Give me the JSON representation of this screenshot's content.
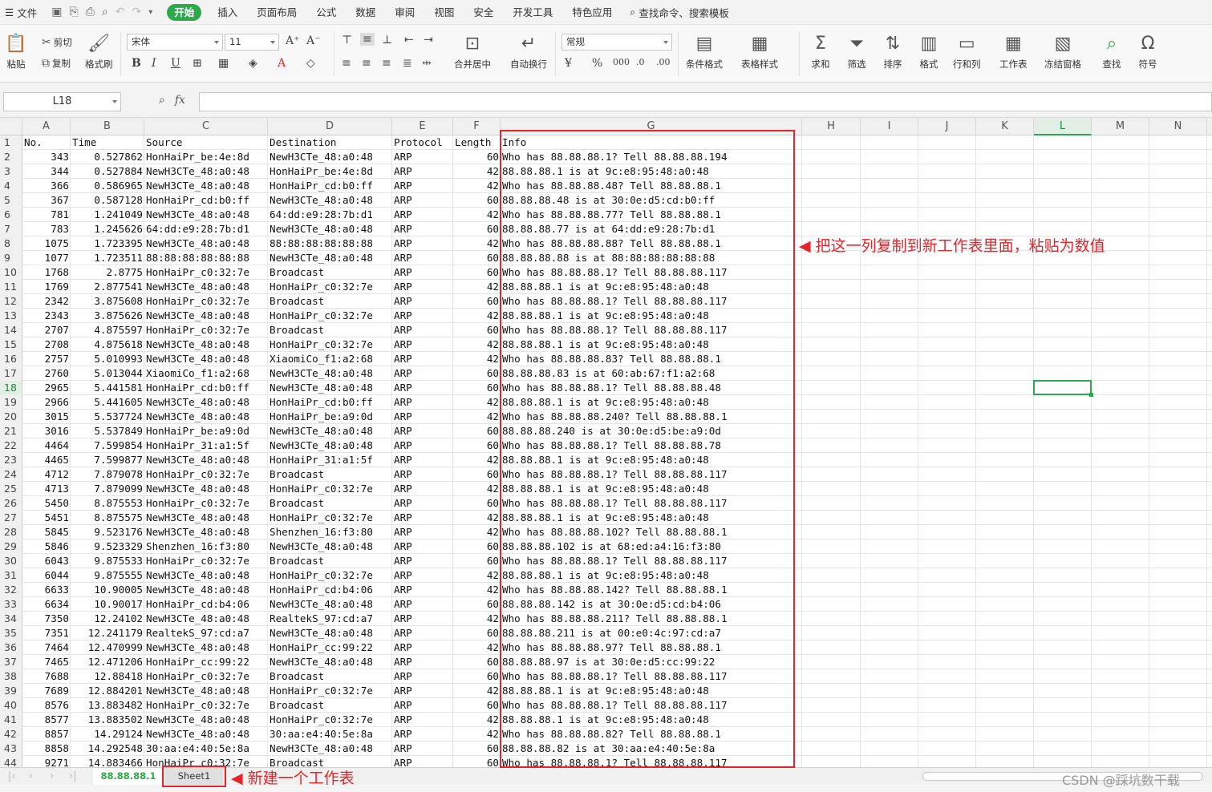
{
  "menubar": {
    "file": "文件",
    "tabs": [
      "开始",
      "插入",
      "页面布局",
      "公式",
      "数据",
      "审阅",
      "视图",
      "安全",
      "开发工具",
      "特色应用"
    ],
    "active": "开始",
    "search": "查找命令、搜索模板"
  },
  "ribbon": {
    "paste": "粘贴",
    "cut": "剪切",
    "copy": "复制",
    "format_painter": "格式刷",
    "font": "宋体",
    "size": "11",
    "merge": "合并居中",
    "wrap": "自动换行",
    "number_format": "常规",
    "cond_format": "条件格式",
    "table_style": "表格样式",
    "sum": "求和",
    "filter": "筛选",
    "sort": "排序",
    "format": "格式",
    "rowcol": "行和列",
    "worksheet": "工作表",
    "freeze": "冻结窗格",
    "find": "查找",
    "symbol": "符号"
  },
  "formula": {
    "name_box": "L18",
    "fx": "fx"
  },
  "columns": [
    "A",
    "B",
    "C",
    "D",
    "E",
    "F",
    "G",
    "H",
    "I",
    "J",
    "K",
    "L",
    "M",
    "N"
  ],
  "selected_column": "L",
  "selected_row": "18",
  "header_row": [
    "No.",
    "Time",
    "Source",
    "Destination",
    "Protocol",
    "Length",
    "Info"
  ],
  "rows": [
    [
      "343",
      "0.527862",
      "HonHaiPr_be:4e:8d",
      "NewH3CTe_48:a0:48",
      "ARP",
      "60",
      "Who has 88.88.88.1? Tell 88.88.88.194"
    ],
    [
      "344",
      "0.527884",
      "NewH3CTe_48:a0:48",
      "HonHaiPr_be:4e:8d",
      "ARP",
      "42",
      "88.88.88.1 is at 9c:e8:95:48:a0:48"
    ],
    [
      "366",
      "0.586965",
      "NewH3CTe_48:a0:48",
      "HonHaiPr_cd:b0:ff",
      "ARP",
      "42",
      "Who has 88.88.88.48? Tell 88.88.88.1"
    ],
    [
      "367",
      "0.587128",
      "HonHaiPr_cd:b0:ff",
      "NewH3CTe_48:a0:48",
      "ARP",
      "60",
      "88.88.88.48 is at 30:0e:d5:cd:b0:ff"
    ],
    [
      "781",
      "1.241049",
      "NewH3CTe_48:a0:48",
      "64:dd:e9:28:7b:d1",
      "ARP",
      "42",
      "Who has 88.88.88.77? Tell 88.88.88.1"
    ],
    [
      "783",
      "1.245626",
      "64:dd:e9:28:7b:d1",
      "NewH3CTe_48:a0:48",
      "ARP",
      "60",
      "88.88.88.77 is at 64:dd:e9:28:7b:d1"
    ],
    [
      "1075",
      "1.723395",
      "NewH3CTe_48:a0:48",
      "88:88:88:88:88:88",
      "ARP",
      "42",
      "Who has 88.88.88.88? Tell 88.88.88.1"
    ],
    [
      "1077",
      "1.723511",
      "88:88:88:88:88:88",
      "NewH3CTe_48:a0:48",
      "ARP",
      "60",
      "88.88.88.88 is at 88:88:88:88:88:88"
    ],
    [
      "1768",
      "2.8775",
      "HonHaiPr_c0:32:7e",
      "Broadcast",
      "ARP",
      "60",
      "Who has 88.88.88.1? Tell 88.88.88.117"
    ],
    [
      "1769",
      "2.877541",
      "NewH3CTe_48:a0:48",
      "HonHaiPr_c0:32:7e",
      "ARP",
      "42",
      "88.88.88.1 is at 9c:e8:95:48:a0:48"
    ],
    [
      "2342",
      "3.875608",
      "HonHaiPr_c0:32:7e",
      "Broadcast",
      "ARP",
      "60",
      "Who has 88.88.88.1? Tell 88.88.88.117"
    ],
    [
      "2343",
      "3.875626",
      "NewH3CTe_48:a0:48",
      "HonHaiPr_c0:32:7e",
      "ARP",
      "42",
      "88.88.88.1 is at 9c:e8:95:48:a0:48"
    ],
    [
      "2707",
      "4.875597",
      "HonHaiPr_c0:32:7e",
      "Broadcast",
      "ARP",
      "60",
      "Who has 88.88.88.1? Tell 88.88.88.117"
    ],
    [
      "2708",
      "4.875618",
      "NewH3CTe_48:a0:48",
      "HonHaiPr_c0:32:7e",
      "ARP",
      "42",
      "88.88.88.1 is at 9c:e8:95:48:a0:48"
    ],
    [
      "2757",
      "5.010993",
      "NewH3CTe_48:a0:48",
      "XiaomiCo_f1:a2:68",
      "ARP",
      "42",
      "Who has 88.88.88.83? Tell 88.88.88.1"
    ],
    [
      "2760",
      "5.013044",
      "XiaomiCo_f1:a2:68",
      "NewH3CTe_48:a0:48",
      "ARP",
      "60",
      "88.88.88.83 is at 60:ab:67:f1:a2:68"
    ],
    [
      "2965",
      "5.441581",
      "HonHaiPr_cd:b0:ff",
      "NewH3CTe_48:a0:48",
      "ARP",
      "60",
      "Who has 88.88.88.1? Tell 88.88.88.48"
    ],
    [
      "2966",
      "5.441605",
      "NewH3CTe_48:a0:48",
      "HonHaiPr_cd:b0:ff",
      "ARP",
      "42",
      "88.88.88.1 is at 9c:e8:95:48:a0:48"
    ],
    [
      "3015",
      "5.537724",
      "NewH3CTe_48:a0:48",
      "HonHaiPr_be:a9:0d",
      "ARP",
      "42",
      "Who has 88.88.88.240? Tell 88.88.88.1"
    ],
    [
      "3016",
      "5.537849",
      "HonHaiPr_be:a9:0d",
      "NewH3CTe_48:a0:48",
      "ARP",
      "60",
      "88.88.88.240 is at 30:0e:d5:be:a9:0d"
    ],
    [
      "4464",
      "7.599854",
      "HonHaiPr_31:a1:5f",
      "NewH3CTe_48:a0:48",
      "ARP",
      "60",
      "Who has 88.88.88.1? Tell 88.88.88.78"
    ],
    [
      "4465",
      "7.599877",
      "NewH3CTe_48:a0:48",
      "HonHaiPr_31:a1:5f",
      "ARP",
      "42",
      "88.88.88.1 is at 9c:e8:95:48:a0:48"
    ],
    [
      "4712",
      "7.879078",
      "HonHaiPr_c0:32:7e",
      "Broadcast",
      "ARP",
      "60",
      "Who has 88.88.88.1? Tell 88.88.88.117"
    ],
    [
      "4713",
      "7.879099",
      "NewH3CTe_48:a0:48",
      "HonHaiPr_c0:32:7e",
      "ARP",
      "42",
      "88.88.88.1 is at 9c:e8:95:48:a0:48"
    ],
    [
      "5450",
      "8.875553",
      "HonHaiPr_c0:32:7e",
      "Broadcast",
      "ARP",
      "60",
      "Who has 88.88.88.1? Tell 88.88.88.117"
    ],
    [
      "5451",
      "8.875575",
      "NewH3CTe_48:a0:48",
      "HonHaiPr_c0:32:7e",
      "ARP",
      "42",
      "88.88.88.1 is at 9c:e8:95:48:a0:48"
    ],
    [
      "5845",
      "9.523176",
      "NewH3CTe_48:a0:48",
      "Shenzhen_16:f3:80",
      "ARP",
      "42",
      "Who has 88.88.88.102? Tell 88.88.88.1"
    ],
    [
      "5846",
      "9.523329",
      "Shenzhen_16:f3:80",
      "NewH3CTe_48:a0:48",
      "ARP",
      "60",
      "88.88.88.102 is at 68:ed:a4:16:f3:80"
    ],
    [
      "6043",
      "9.875533",
      "HonHaiPr_c0:32:7e",
      "Broadcast",
      "ARP",
      "60",
      "Who has 88.88.88.1? Tell 88.88.88.117"
    ],
    [
      "6044",
      "9.875555",
      "NewH3CTe_48:a0:48",
      "HonHaiPr_c0:32:7e",
      "ARP",
      "42",
      "88.88.88.1 is at 9c:e8:95:48:a0:48"
    ],
    [
      "6633",
      "10.90005",
      "NewH3CTe_48:a0:48",
      "HonHaiPr_cd:b4:06",
      "ARP",
      "42",
      "Who has 88.88.88.142? Tell 88.88.88.1"
    ],
    [
      "6634",
      "10.90017",
      "HonHaiPr_cd:b4:06",
      "NewH3CTe_48:a0:48",
      "ARP",
      "60",
      "88.88.88.142 is at 30:0e:d5:cd:b4:06"
    ],
    [
      "7350",
      "12.24102",
      "NewH3CTe_48:a0:48",
      "RealtekS_97:cd:a7",
      "ARP",
      "42",
      "Who has 88.88.88.211? Tell 88.88.88.1"
    ],
    [
      "7351",
      "12.241179",
      "RealtekS_97:cd:a7",
      "NewH3CTe_48:a0:48",
      "ARP",
      "60",
      "88.88.88.211 is at 00:e0:4c:97:cd:a7"
    ],
    [
      "7464",
      "12.470999",
      "NewH3CTe_48:a0:48",
      "HonHaiPr_cc:99:22",
      "ARP",
      "42",
      "Who has 88.88.88.97? Tell 88.88.88.1"
    ],
    [
      "7465",
      "12.471206",
      "HonHaiPr_cc:99:22",
      "NewH3CTe_48:a0:48",
      "ARP",
      "60",
      "88.88.88.97 is at 30:0e:d5:cc:99:22"
    ],
    [
      "7688",
      "12.88418",
      "HonHaiPr_c0:32:7e",
      "Broadcast",
      "ARP",
      "60",
      "Who has 88.88.88.1? Tell 88.88.88.117"
    ],
    [
      "7689",
      "12.884201",
      "NewH3CTe_48:a0:48",
      "HonHaiPr_c0:32:7e",
      "ARP",
      "42",
      "88.88.88.1 is at 9c:e8:95:48:a0:48"
    ],
    [
      "8576",
      "13.883482",
      "HonHaiPr_c0:32:7e",
      "Broadcast",
      "ARP",
      "60",
      "Who has 88.88.88.1? Tell 88.88.88.117"
    ],
    [
      "8577",
      "13.883502",
      "NewH3CTe_48:a0:48",
      "HonHaiPr_c0:32:7e",
      "ARP",
      "42",
      "88.88.88.1 is at 9c:e8:95:48:a0:48"
    ],
    [
      "8857",
      "14.29124",
      "NewH3CTe_48:a0:48",
      "30:aa:e4:40:5e:8a",
      "ARP",
      "42",
      "Who has 88.88.88.82? Tell 88.88.88.1"
    ],
    [
      "8858",
      "14.292548",
      "30:aa:e4:40:5e:8a",
      "NewH3CTe_48:a0:48",
      "ARP",
      "60",
      "88.88.88.82 is at 30:aa:e4:40:5e:8a"
    ],
    [
      "9271",
      "14.883466",
      "HonHaiPr_c0:32:7e",
      "Broadcast",
      "ARP",
      "60",
      "Who has 88.88.88.1? Tell 88.88.88.117"
    ]
  ],
  "sheets": [
    "88.88.88.1",
    "Sheet1"
  ],
  "active_sheet": "88.88.88.1",
  "annotations": {
    "copy_column": "把这一列复制到新工作表里面，粘贴为数值",
    "new_sheet": "新建一个工作表"
  },
  "watermark": "CSDN @踩坑数干载",
  "colors": {
    "accent": "#2da84a",
    "annotation": "#e8242b"
  }
}
